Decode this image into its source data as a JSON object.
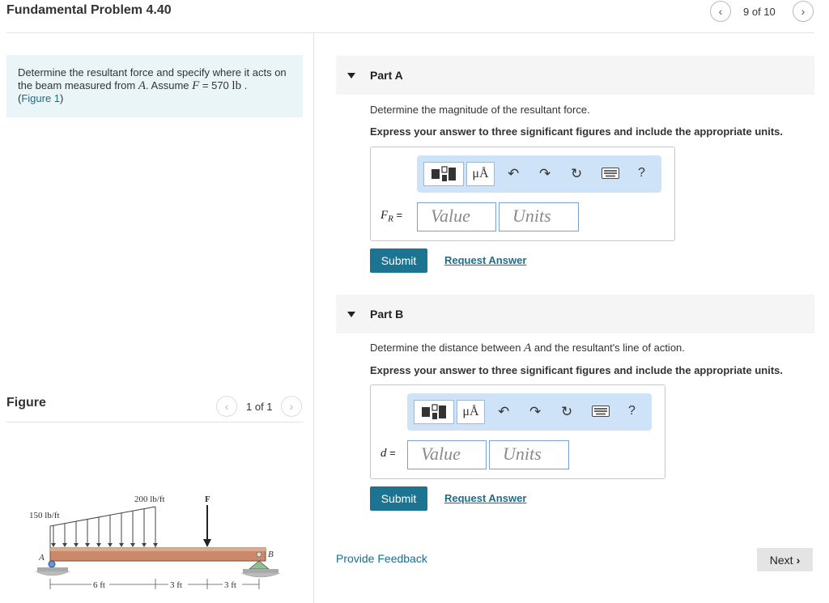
{
  "header": {
    "title": "Fundamental Problem 4.40",
    "pager": "9 of 10"
  },
  "problem": {
    "text_before": "Determine the resultant force and specify where it acts on the beam measured from ",
    "point": "A",
    "text_middle": ". Assume ",
    "var": "F",
    "equals": " = 570 ",
    "unit": "lb",
    "text_end": " .",
    "figure_link": "Figure 1",
    "figure_paren_open": "(",
    "figure_paren_close": ")"
  },
  "figure": {
    "label": "Figure",
    "pager": "1 of 1",
    "load_left": "150 lb/ft",
    "load_peak": "200 lb/ft",
    "force_label": "F",
    "point_a": "A",
    "point_b": "B",
    "dim_1": "6 ft",
    "dim_2": "3 ft",
    "dim_3": "3 ft"
  },
  "partA": {
    "title": "Part A",
    "question": "Determine the magnitude of the resultant force.",
    "instruction": "Express your answer to three significant figures and include the appropriate units.",
    "label_var": "F",
    "label_sub": "R",
    "label_eq": " =",
    "value_placeholder": "Value",
    "units_placeholder": "Units",
    "submit": "Submit",
    "request": "Request Answer"
  },
  "partB": {
    "title": "Part B",
    "question_before": "Determine the distance between ",
    "question_point": "A",
    "question_after": " and the resultant's line of action.",
    "instruction": "Express your answer to three significant figures and include the appropriate units.",
    "label_var": "d",
    "label_eq": " =",
    "value_placeholder": "Value",
    "units_placeholder": "Units",
    "submit": "Submit",
    "request": "Request Answer"
  },
  "toolbar": {
    "mu_label": "μÅ",
    "help_label": "?"
  },
  "footer": {
    "feedback": "Provide Feedback",
    "next": "Next"
  },
  "colors": {
    "accent": "#1b7592",
    "link": "#1a6e8e",
    "problem_bg": "#e9f5f7",
    "toolbar_bg": "#cfe3f8"
  }
}
